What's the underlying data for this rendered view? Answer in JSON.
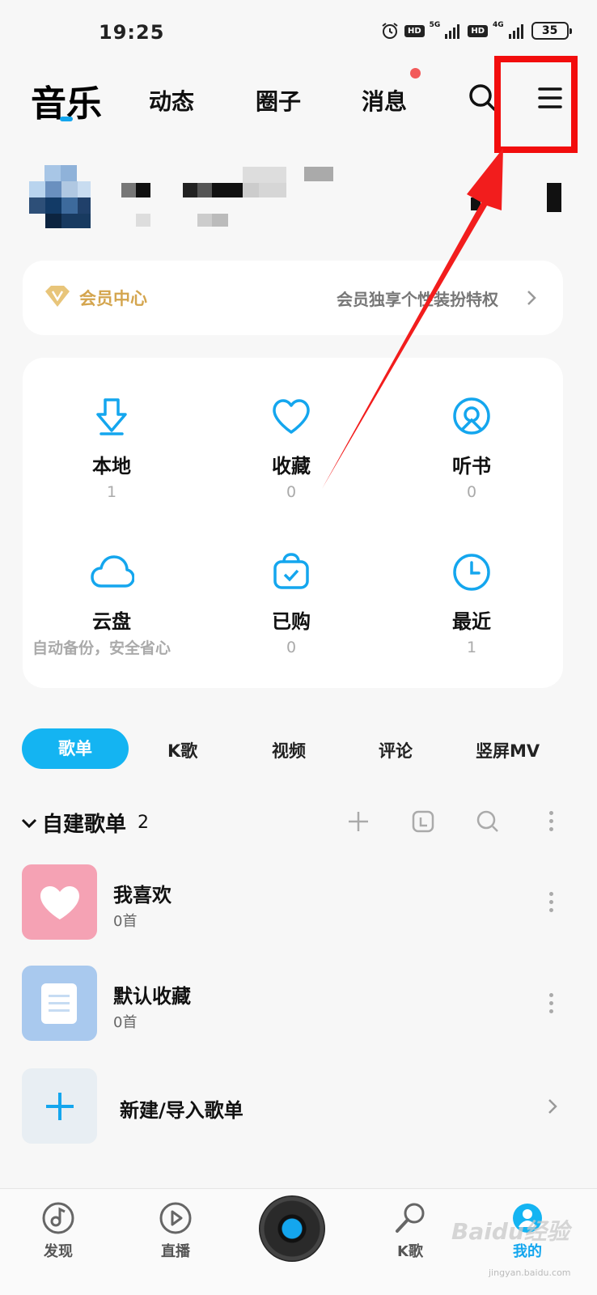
{
  "status_bar": {
    "time": "19:25",
    "net1": "5G",
    "net2": "4G",
    "hd": "HD",
    "battery": "35"
  },
  "top_nav": {
    "main": "音乐",
    "tabs": [
      "动态",
      "圈子",
      "消息"
    ]
  },
  "vip": {
    "title": "会员中心",
    "desc": "会员独享个性装扮特权"
  },
  "grid": [
    {
      "label": "本地",
      "count": "1",
      "icon": "download-icon"
    },
    {
      "label": "收藏",
      "count": "0",
      "icon": "heart-icon"
    },
    {
      "label": "听书",
      "count": "0",
      "icon": "podcast-icon"
    },
    {
      "label": "云盘",
      "count": "",
      "icon": "cloud-icon"
    },
    {
      "label": "已购",
      "count": "0",
      "icon": "purchased-bag-icon"
    },
    {
      "label": "最近",
      "count": "1",
      "icon": "clock-icon"
    }
  ],
  "cloud_desc": "自动备份，安全省心",
  "segments": [
    "歌单",
    "K歌",
    "视频",
    "评论",
    "竖屏MV"
  ],
  "playlist_section": {
    "title": "自建歌单",
    "count": "2"
  },
  "playlists": [
    {
      "name": "我喜欢",
      "sub": "0首"
    },
    {
      "name": "默认收藏",
      "sub": "0首"
    }
  ],
  "new_playlist": "新建/导入歌单",
  "bottom_nav": [
    "发现",
    "直播",
    "K歌",
    "我的"
  ],
  "watermark": {
    "main": "Baidu经验",
    "sub": "jingyan.baidu.com"
  },
  "colors": {
    "accent": "#14b4f2",
    "highlight": "#f20d0d",
    "vip_gold": "#d4a54e"
  }
}
